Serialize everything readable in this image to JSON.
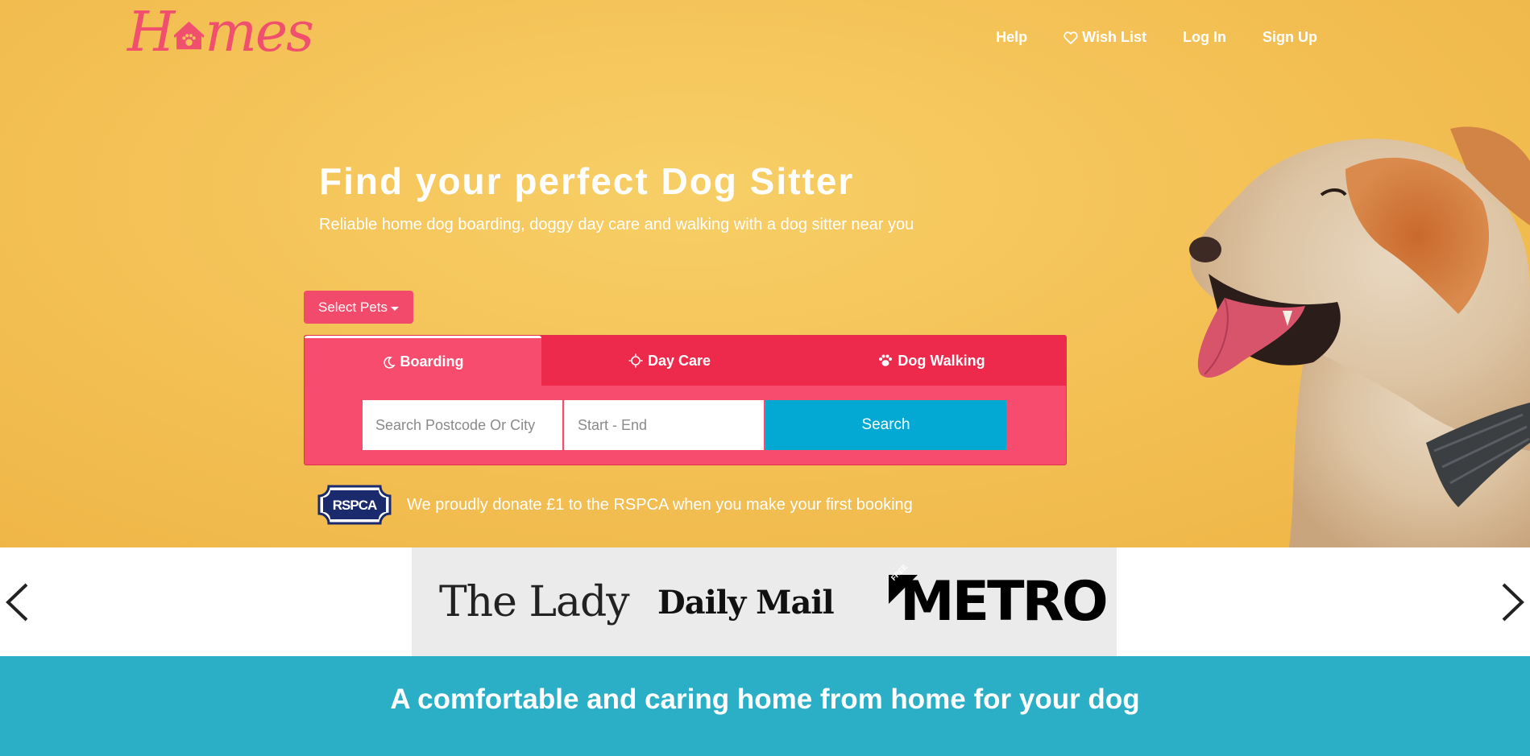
{
  "brand": {
    "name": "Homes"
  },
  "nav": {
    "help": "Help",
    "wishlist": "Wish List",
    "login": "Log In",
    "signup": "Sign Up"
  },
  "hero": {
    "headline": "Find your perfect Dog Sitter",
    "subline": "Reliable home dog boarding, doggy day care and walking with a dog sitter near you",
    "select_pets": "Select Pets"
  },
  "search": {
    "tabs": [
      {
        "label": "Boarding",
        "icon": "moon-icon",
        "active": true
      },
      {
        "label": "Day Care",
        "icon": "sun-icon",
        "active": false
      },
      {
        "label": "Dog Walking",
        "icon": "paw-icon",
        "active": false
      }
    ],
    "postcode_placeholder": "Search Postcode Or City",
    "dates_placeholder": "Start - End",
    "button": "Search"
  },
  "rspca": {
    "logo_text": "RSPCA",
    "message": "We proudly donate £1 to the RSPCA when you make your first booking"
  },
  "press": {
    "logos": [
      "The Lady",
      "Daily Mail",
      "METRO"
    ],
    "metro_badge": "FREE"
  },
  "bottom": {
    "tagline": "A comfortable and caring home from home for your dog"
  },
  "colors": {
    "hero_bg": "#f4c257",
    "brand_pink": "#f0506e",
    "tab_bar": "#ee2a4c",
    "panel": "#f74c6d",
    "search_btn": "#03a9d3",
    "banner": "#2aafc6"
  }
}
